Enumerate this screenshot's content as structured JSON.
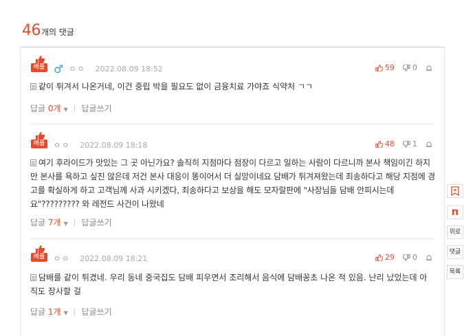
{
  "header": {
    "count": "46",
    "label": "개의 댓글"
  },
  "comments": [
    {
      "badge": "베플",
      "gender": "♂",
      "nick": "ㅇㅇ",
      "date": "2022.08.09 18:52",
      "up": "59",
      "down": "0",
      "text": "같이 튀겨서 나온거네, 이건 중립 박을 필요도 없이 금융치료 가야죠 식약처 ㄱㄱ",
      "reply_label": "답글",
      "reply_count": "0개",
      "write_label": "답글쓰기"
    },
    {
      "badge": "베플",
      "nick": "ㅇㅇ",
      "date": "2022.08.09 18:18",
      "up": "48",
      "down": "1",
      "text": "여기 후라이드가 맛있는 그 곳 아닌가요? 솔직히 지점마다 점장이 다르고 일하는 사람이 다르니까 본사 책임이긴 하지만 본사를 욕하고 싶진 않은데 저건 본사 대응이 똥이어서 더 실망이네요 담배가 튀겨져왔는데 죄송하다고 해당 지점에 경고를 확실하게 하고 고객님께 사과 시키겠다, 죄송하다고 보상을 해도 모자랄판에 \"사장님들 담배 안피시는데요\"????????? 와 레전드 사건이 나왔네",
      "reply_label": "답글",
      "reply_count": "7개",
      "write_label": "답글쓰기"
    },
    {
      "badge": "베플",
      "nick": "ㅇㅇ",
      "date": "2022.08.09 18:21",
      "up": "29",
      "down": "0",
      "text": "담배를 같이 튀겼네. 우리 동네 중국집도 담배 피우면서 조리해서 음식에 담배꽁초 나온 적 있음. 난리 났었는데 아직도 장사할 걸",
      "reply_label": "답글",
      "reply_count": "1개",
      "write_label": "답글쓰기"
    }
  ],
  "sidebar": {
    "n_label": "n",
    "up_label": "위로",
    "reply_label": "댓글",
    "list_label": "목록"
  },
  "colors": {
    "accent": "#e54b2b",
    "male": "#2fa3d9"
  }
}
